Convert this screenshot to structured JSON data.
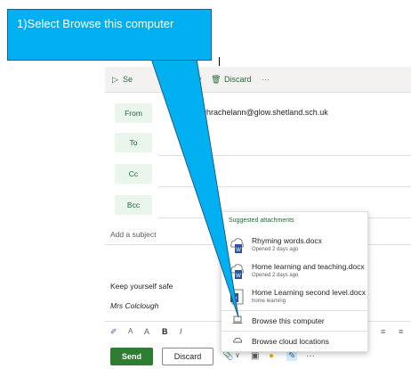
{
  "toolbar": {
    "send_label": "Se",
    "discard_label": "Discard",
    "more": "···"
  },
  "fields": {
    "from_label": "From",
    "from_value": "loughrachelann@glow.shetland.sch.uk",
    "to_label": "To",
    "cc_label": "Cc",
    "bcc_label": "Bcc"
  },
  "subject": {
    "placeholder": "Add a subject"
  },
  "body": {
    "line1": "Keep yourself safe",
    "signature": "Mrs Colclough"
  },
  "attachments_popup": {
    "title": "Suggested attachments",
    "files": [
      {
        "name": "Rhyming words.docx",
        "meta": "Opened 2 days ago"
      },
      {
        "name": "Home learning and teaching.docx",
        "meta": "Opened 2 days ago"
      },
      {
        "name": "Home Learning second level.docx",
        "meta": "home learning"
      }
    ],
    "browse_computer": "Browse this computer",
    "browse_cloud": "Browse cloud locations"
  },
  "format_bar": {
    "font_size_small": "A",
    "font_size_large": "A",
    "bold": "B",
    "italic": "I"
  },
  "bottom": {
    "send": "Send",
    "discard": "Discard",
    "more": "···"
  },
  "callout": {
    "text": "1)Select Browse this computer"
  },
  "colors": {
    "accent_green": "#2e7d32",
    "callout_blue": "#00b0f0"
  }
}
